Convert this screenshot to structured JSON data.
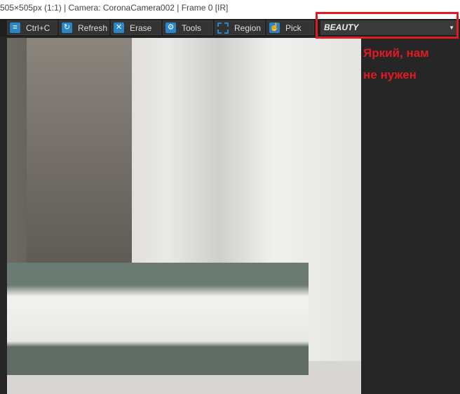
{
  "title": "505×505px (1:1) | Camera: CoronaCamera002 | Frame 0 [IR]",
  "toolbar": {
    "copy": "Ctrl+C",
    "refresh": "Refresh",
    "erase": "Erase",
    "tools": "Tools",
    "region": "Region",
    "pick": "Pick",
    "channel": "BEAUTY"
  },
  "annotation": {
    "line1": "Яркий, нам",
    "line2": "не нужен"
  },
  "colors": {
    "accent": "#2a86c9",
    "highlight": "#e01b24"
  }
}
